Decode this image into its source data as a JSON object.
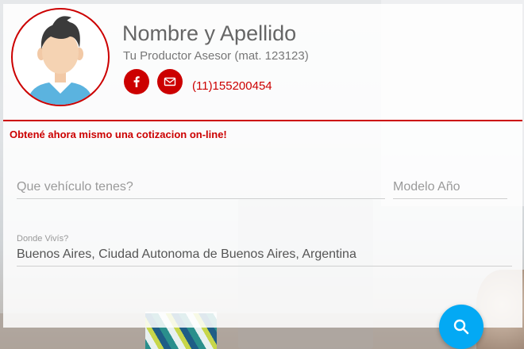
{
  "advisor": {
    "name": "Nombre y Apellido",
    "subtitle": "Tu Productor Asesor (mat. 123123)",
    "phone": "(11)155200454"
  },
  "social": {
    "facebook_icon": "facebook-icon",
    "email_icon": "envelope-icon"
  },
  "quote_form": {
    "cta": "Obtené ahora mismo una cotizacion on-line!",
    "vehicle_placeholder": "Que vehículo tenes?",
    "vehicle_value": "",
    "model_year_placeholder": "Modelo Año",
    "model_year_value": "",
    "location_label": "Donde Vivís?",
    "location_value": "Buenos Aires, Ciudad Autonoma de Buenos Aires, Argentina"
  },
  "search_button": {
    "icon": "search-icon"
  },
  "colors": {
    "brand_red": "#cc0000",
    "fab_blue": "#03a9f4"
  }
}
